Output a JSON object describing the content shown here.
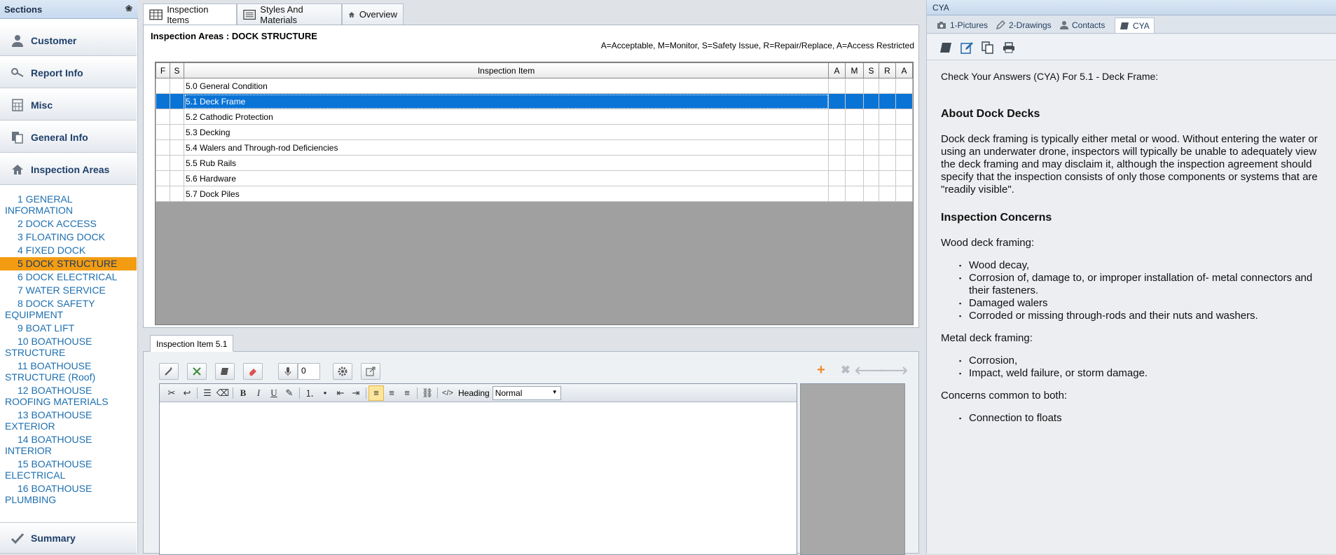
{
  "sidebar": {
    "title": "Sections",
    "sections": [
      {
        "label": "Customer",
        "icon": "person-icon"
      },
      {
        "label": "Report Info",
        "icon": "key-icon"
      },
      {
        "label": "Misc",
        "icon": "calculator-icon"
      },
      {
        "label": "General Info",
        "icon": "documents-icon"
      },
      {
        "label": "Inspection Areas",
        "icon": "home-icon"
      }
    ],
    "areas": [
      "1 GENERAL INFORMATION",
      "2 DOCK ACCESS",
      "3 FLOATING DOCK",
      "4 FIXED DOCK",
      "5 DOCK STRUCTURE",
      "6 DOCK ELECTRICAL",
      "7 WATER SERVICE",
      "8 DOCK SAFETY EQUIPMENT",
      "9 BOAT LIFT",
      "10 BOATHOUSE STRUCTURE",
      "11 BOATHOUSE STRUCTURE (Roof)",
      "12 BOATHOUSE ROOFING MATERIALS",
      "13 BOATHOUSE EXTERIOR",
      "14 BOATHOUSE INTERIOR",
      "15 BOATHOUSE ELECTRICAL",
      "16 BOATHOUSE PLUMBING"
    ],
    "selected_area": "5 DOCK STRUCTURE",
    "summary_label": "Summary"
  },
  "center_tabs": [
    {
      "label": "Inspection Items",
      "icon": "table-icon"
    },
    {
      "label": "Styles And Materials",
      "icon": "list-icon"
    },
    {
      "label": "Overview",
      "icon": "home-icon"
    }
  ],
  "inspection": {
    "title": "Inspection Areas : DOCK STRUCTURE",
    "legend": "A=Acceptable, M=Monitor, S=Safety Issue, R=Repair/Replace, A=Access Restricted",
    "columns": [
      "F",
      "S",
      "Inspection Item",
      "A",
      "M",
      "S",
      "R",
      "A"
    ],
    "items": [
      "5.0 General Condition",
      "5.1 Deck Frame",
      "5.2 Cathodic Protection",
      "5.3 Decking",
      "5.4 Walers and Through-rod Deficiencies",
      "5.5 Rub Rails",
      "5.6 Hardware",
      "5.7 Dock Piles"
    ],
    "selected_item": "5.1 Deck Frame"
  },
  "bottom_panel": {
    "tab_label": "Inspection Item 5.1",
    "counter_value": "0",
    "heading_label": "Heading",
    "heading_value": "Normal"
  },
  "cya": {
    "window_title": "CYA",
    "tabs": [
      {
        "label": "1-Pictures",
        "icon": "camera-icon"
      },
      {
        "label": "2-Drawings",
        "icon": "pencil-icon"
      },
      {
        "label": "Contacts",
        "icon": "person-icon"
      },
      {
        "label": "CYA",
        "icon": "book-icon"
      }
    ],
    "intro": "Check Your Answers (CYA) For 5.1 - Deck Frame:",
    "about_heading": "About Dock Decks",
    "about_text": "Dock deck framing is typically either metal or wood. Without entering the water or using an underwater drone, inspectors will typically be unable to adequately view the deck framing and may disclaim it, although the inspection agreement should specify that the inspection consists of only those components or systems that are \"readily visible\".",
    "concerns_heading": "Inspection Concerns",
    "wood_label": "Wood deck framing:",
    "wood_items": [
      "Wood decay,",
      "Corrosion of, damage to, or improper installation of- metal connectors and their fasteners.",
      "Damaged walers",
      "Corroded or missing through-rods and their nuts and washers."
    ],
    "metal_label": "Metal deck framing:",
    "metal_items": [
      "Corrosion,",
      "Impact, weld failure, or storm damage."
    ],
    "both_label": "Concerns common to both:",
    "both_items": [
      "Connection to floats"
    ]
  },
  "colors": {
    "accent_selected_area": "#f39c12",
    "selected_row": "#0a74d6",
    "link_blue": "#1d6fb0"
  }
}
